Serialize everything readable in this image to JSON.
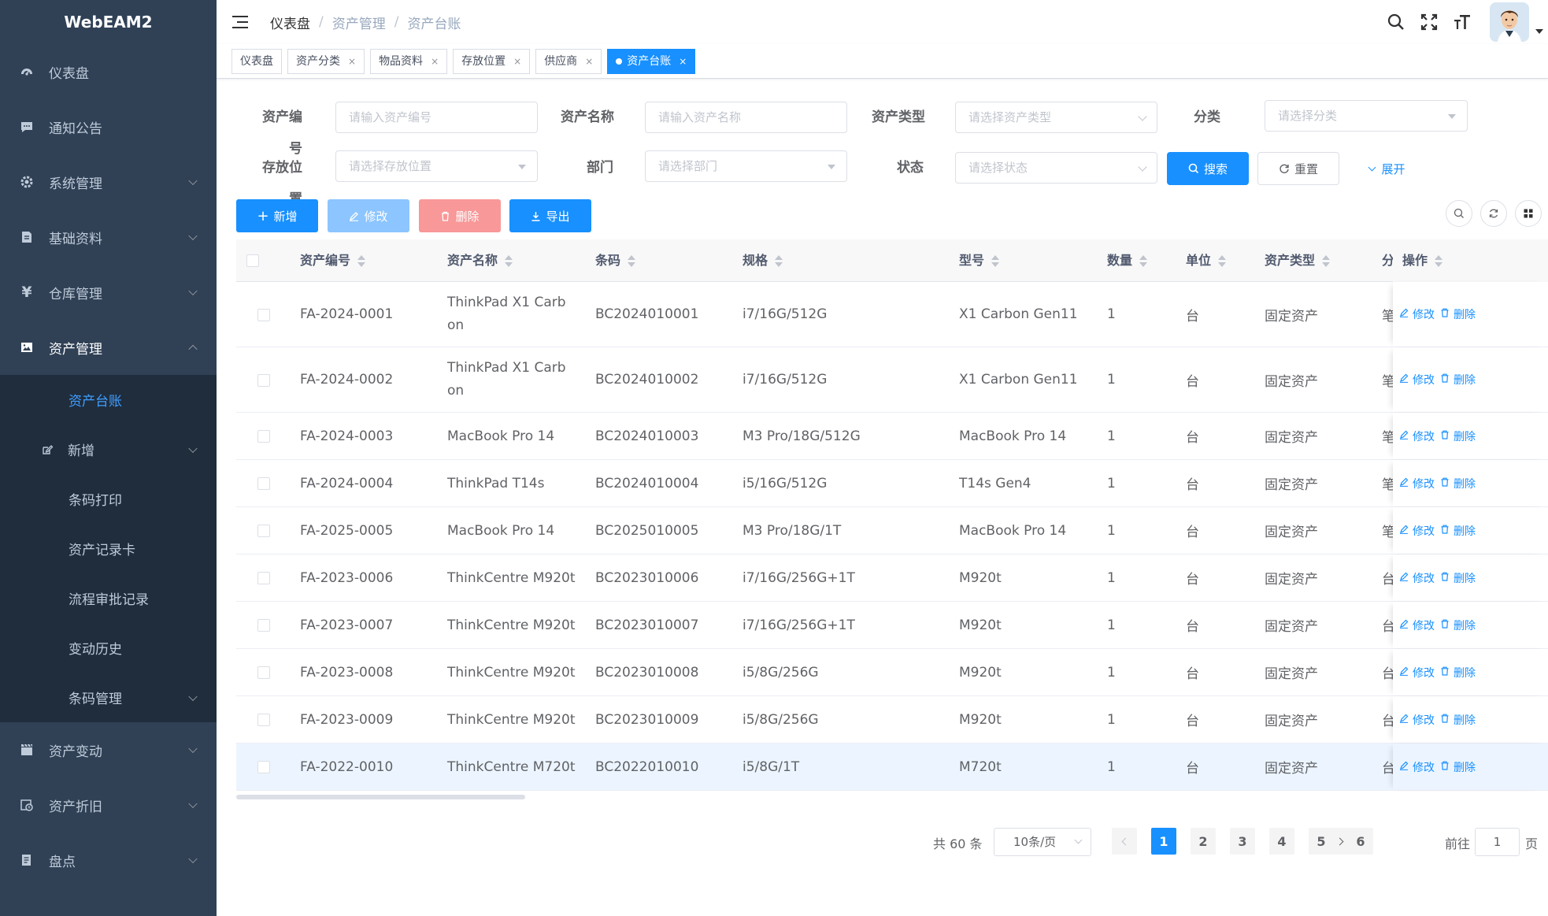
{
  "app": {
    "title": "WebEAM2"
  },
  "sidebar": {
    "items": [
      {
        "label": "仪表盘",
        "icon": "dashboard-icon"
      },
      {
        "label": "通知公告",
        "icon": "message-icon"
      },
      {
        "label": "系统管理",
        "icon": "gear-icon"
      },
      {
        "label": "基础资料",
        "icon": "document-icon"
      },
      {
        "label": "仓库管理",
        "icon": "yen-icon"
      },
      {
        "label": "资产管理",
        "icon": "image-icon"
      }
    ],
    "submenu": [
      {
        "label": "资产台账",
        "active": true
      },
      {
        "label": "新增",
        "icon": "edit-icon"
      },
      {
        "label": "条码打印"
      },
      {
        "label": "资产记录卡"
      },
      {
        "label": "流程审批记录"
      },
      {
        "label": "变动历史"
      },
      {
        "label": "条码管理"
      }
    ],
    "bottom": [
      {
        "label": "资产变动",
        "icon": "clapper-icon"
      },
      {
        "label": "资产折旧",
        "icon": "depreciation-icon"
      },
      {
        "label": "盘点",
        "icon": "inventory-icon"
      }
    ]
  },
  "breadcrumb": [
    "仪表盘",
    "资产管理",
    "资产台账"
  ],
  "tags": [
    {
      "label": "仪表盘",
      "closable": false
    },
    {
      "label": "资产分类",
      "closable": true
    },
    {
      "label": "物品资料",
      "closable": true
    },
    {
      "label": "存放位置",
      "closable": true
    },
    {
      "label": "供应商",
      "closable": true
    },
    {
      "label": "资产台账",
      "closable": true,
      "active": true
    }
  ],
  "search": {
    "asset_code": {
      "label": "资产编号",
      "placeholder": "请输入资产编号"
    },
    "asset_name": {
      "label": "资产名称",
      "placeholder": "请输入资产名称"
    },
    "asset_type": {
      "label": "资产类型",
      "placeholder": "请选择资产类型"
    },
    "category": {
      "label": "分类",
      "placeholder": "请选择分类"
    },
    "location": {
      "label": "存放位置",
      "placeholder": "请选择存放位置"
    },
    "department": {
      "label": "部门",
      "placeholder": "请选择部门"
    },
    "status": {
      "label": "状态",
      "placeholder": "请选择状态"
    },
    "search_button": "搜索",
    "reset_button": "重置",
    "expand_link": "展开"
  },
  "toolbar": {
    "add": "新增",
    "edit": "修改",
    "delete": "删除",
    "export": "导出"
  },
  "colors": {
    "primary": "#1890ff",
    "success": "#1890ff",
    "danger_disabled": "#f89898",
    "edit_disabled": "#8cc5ff",
    "sidebar": "#304156"
  },
  "table": {
    "columns": [
      "资产编号",
      "资产名称",
      "条码",
      "规格",
      "型号",
      "数量",
      "单位",
      "资产类型",
      "分",
      "操作"
    ],
    "row_actions": {
      "edit": "修改",
      "delete": "删除"
    },
    "rows": [
      {
        "code": "FA-2024-0001",
        "name": "ThinkPad X1 Carbon",
        "barcode": "BC2024010001",
        "spec": "i7/16G/512G",
        "model": "X1 Carbon Gen11",
        "qty": "1",
        "unit": "台",
        "type": "固定资产",
        "cat": "笔"
      },
      {
        "code": "FA-2024-0002",
        "name": "ThinkPad X1 Carbon",
        "barcode": "BC2024010002",
        "spec": "i7/16G/512G",
        "model": "X1 Carbon Gen11",
        "qty": "1",
        "unit": "台",
        "type": "固定资产",
        "cat": "笔"
      },
      {
        "code": "FA-2024-0003",
        "name": "MacBook Pro 14",
        "barcode": "BC2024010003",
        "spec": "M3 Pro/18G/512G",
        "model": "MacBook Pro 14",
        "qty": "1",
        "unit": "台",
        "type": "固定资产",
        "cat": "笔"
      },
      {
        "code": "FA-2024-0004",
        "name": "ThinkPad T14s",
        "barcode": "BC2024010004",
        "spec": "i5/16G/512G",
        "model": "T14s Gen4",
        "qty": "1",
        "unit": "台",
        "type": "固定资产",
        "cat": "笔"
      },
      {
        "code": "FA-2025-0005",
        "name": "MacBook Pro 14",
        "barcode": "BC2025010005",
        "spec": "M3 Pro/18G/1T",
        "model": "MacBook Pro 14",
        "qty": "1",
        "unit": "台",
        "type": "固定资产",
        "cat": "笔"
      },
      {
        "code": "FA-2023-0006",
        "name": "ThinkCentre M920t",
        "barcode": "BC2023010006",
        "spec": "i7/16G/256G+1T",
        "model": "M920t",
        "qty": "1",
        "unit": "台",
        "type": "固定资产",
        "cat": "台"
      },
      {
        "code": "FA-2023-0007",
        "name": "ThinkCentre M920t",
        "barcode": "BC2023010007",
        "spec": "i7/16G/256G+1T",
        "model": "M920t",
        "qty": "1",
        "unit": "台",
        "type": "固定资产",
        "cat": "台"
      },
      {
        "code": "FA-2023-0008",
        "name": "ThinkCentre M920t",
        "barcode": "BC2023010008",
        "spec": "i5/8G/256G",
        "model": "M920t",
        "qty": "1",
        "unit": "台",
        "type": "固定资产",
        "cat": "台"
      },
      {
        "code": "FA-2023-0009",
        "name": "ThinkCentre M920t",
        "barcode": "BC2023010009",
        "spec": "i5/8G/256G",
        "model": "M920t",
        "qty": "1",
        "unit": "台",
        "type": "固定资产",
        "cat": "台"
      },
      {
        "code": "FA-2022-0010",
        "name": "ThinkCentre M720t",
        "barcode": "BC2022010010",
        "spec": "i5/8G/1T",
        "model": "M720t",
        "qty": "1",
        "unit": "台",
        "type": "固定资产",
        "cat": "台"
      }
    ]
  },
  "pagination": {
    "total": "共 60 条",
    "page_size": "10条/页",
    "pages": [
      "1",
      "2",
      "3",
      "4",
      "5",
      "6"
    ],
    "current": "1",
    "jump_prefix": "前往",
    "jump_value": "1",
    "jump_suffix": "页"
  }
}
